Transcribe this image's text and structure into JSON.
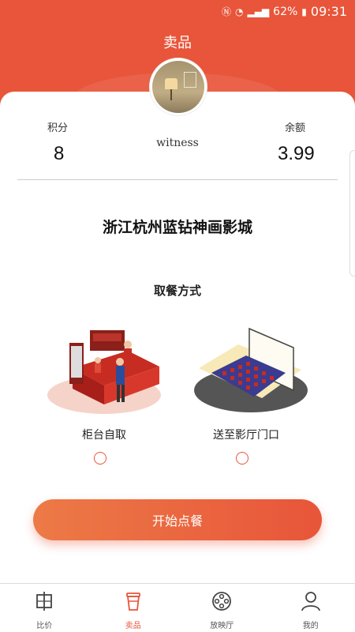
{
  "status_bar": {
    "battery": "62%",
    "time": "09:31"
  },
  "header": {
    "title": "卖品"
  },
  "user": {
    "points_label": "积分",
    "points_value": "8",
    "name": "witness",
    "balance_label": "余额",
    "balance_value": "3.99"
  },
  "cinema_name": "浙江杭州蓝钻神画影城",
  "pickup": {
    "title": "取餐方式",
    "options": [
      {
        "label": "柜台自取",
        "selected": false
      },
      {
        "label": "送至影厅门口",
        "selected": false
      }
    ]
  },
  "order_button": "开始点餐",
  "tabs": [
    {
      "label": "比价",
      "icon": "compare-icon",
      "active": false
    },
    {
      "label": "卖品",
      "icon": "cup-icon",
      "active": true
    },
    {
      "label": "放映厅",
      "icon": "film-reel-icon",
      "active": false
    },
    {
      "label": "我的",
      "icon": "user-icon",
      "active": false
    }
  ],
  "colors": {
    "accent": "#e8553a",
    "accent_light": "#ec7a46"
  }
}
